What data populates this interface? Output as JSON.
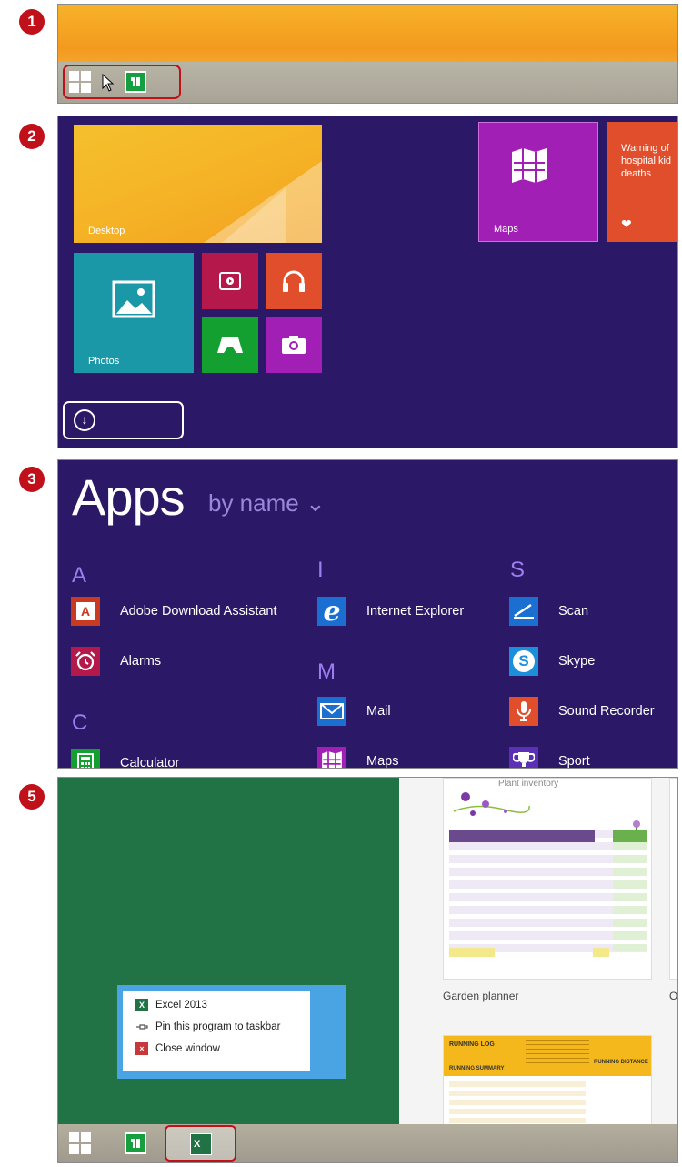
{
  "steps": {
    "s1": "1",
    "s2": "2",
    "s3": "3",
    "s5": "5"
  },
  "start_screen": {
    "tiles": {
      "desktop": "Desktop",
      "photos": "Photos",
      "maps": "Maps",
      "news": "Warning of hospital kid deaths"
    },
    "down_arrow": "↓"
  },
  "apps_view": {
    "title": "Apps",
    "sort": "by name ⌄",
    "groups": {
      "A": "A",
      "C": "C",
      "I": "I",
      "M": "M",
      "S": "S"
    },
    "items": {
      "adobe": "Adobe Download Assistant",
      "alarms": "Alarms",
      "calculator": "Calculator",
      "ie": "Internet Explorer",
      "mail": "Mail",
      "maps": "Maps",
      "scan": "Scan",
      "skype": "Skype",
      "sound": "Sound Recorder",
      "sport": "Sport"
    }
  },
  "excel_view": {
    "thumb_title": "Plant inventory",
    "garden": "Garden planner",
    "running_log": "RUNNING LOG",
    "running_summary": "RUNNING SUMMARY",
    "running_distance": "RUNNING DISTANCE",
    "context_menu": {
      "app": "Excel 2013",
      "pin": "Pin this program to taskbar",
      "close": "Close window"
    },
    "xl_badge": "X"
  },
  "colors": {
    "accent": "#c0101a",
    "start_bg": "#2b1866",
    "excel_green": "#217346"
  }
}
